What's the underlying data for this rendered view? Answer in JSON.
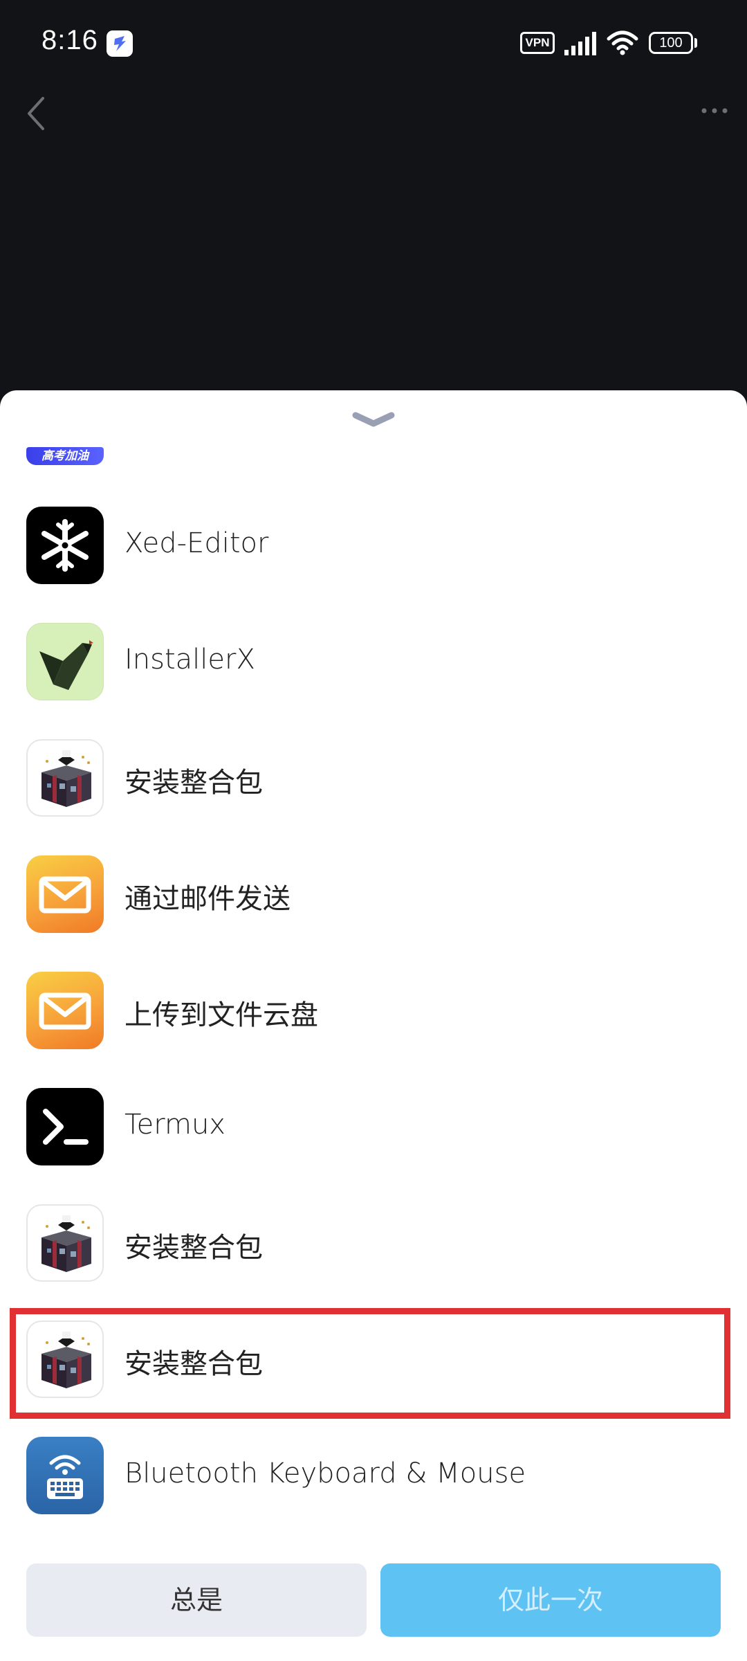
{
  "status_bar": {
    "time": "8:16",
    "vpn": "VPN",
    "battery": "100"
  },
  "sheet": {
    "promo_badge": "高考加油",
    "apps": [
      {
        "label": "Xed-Editor",
        "icon": "xed-editor-icon"
      },
      {
        "label": "InstallerX",
        "icon": "installerx-icon"
      },
      {
        "label": "安装整合包",
        "icon": "modpack-installer-icon"
      },
      {
        "label": "通过邮件发送",
        "icon": "mail-icon"
      },
      {
        "label": "上传到文件云盘",
        "icon": "mail-icon"
      },
      {
        "label": "Termux",
        "icon": "termux-icon"
      },
      {
        "label": "安装整合包",
        "icon": "modpack-installer-icon"
      },
      {
        "label": "安装整合包",
        "icon": "modpack-installer-icon"
      },
      {
        "label": "Bluetooth Keyboard & Mouse",
        "icon": "bluetooth-keyboard-icon"
      }
    ],
    "buttons": {
      "always": "总是",
      "just_once": "仅此一次"
    }
  },
  "colors": {
    "background_dark": "#121316",
    "highlight": "#e03034",
    "primary_button": "#5ec3f3",
    "secondary_button": "#e9ebf2"
  }
}
